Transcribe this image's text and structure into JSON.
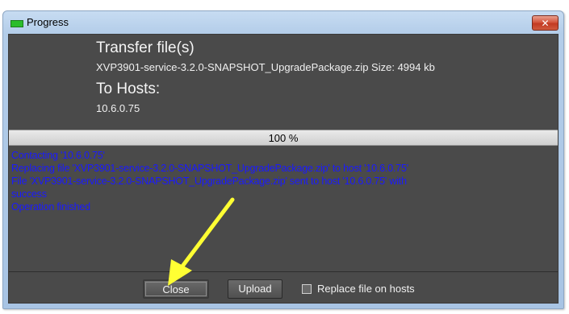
{
  "window": {
    "title": "Progress",
    "close_glyph": "✕"
  },
  "transfer": {
    "heading": "Transfer file(s)",
    "file_info": "XVP3901-service-3.2.0-SNAPSHOT_UpgradePackage.zip Size: 4994 kb",
    "hosts_heading": "To Hosts:",
    "host": "10.6.0.75"
  },
  "progress": {
    "value": 100,
    "label": "100 %"
  },
  "log": {
    "color": "#1a1aff",
    "lines": [
      "Contacting '10.6.0.75'",
      "Replacing file 'XVP3901-service-3.2.0-SNAPSHOT_UpgradePackage.zip' to host '10.6.0.75'",
      "File  'XVP3901-service-3.2.0-SNAPSHOT_UpgradePackage.zip' sent to host '10.6.0.75' with",
      "success",
      "Operation finished"
    ]
  },
  "footer": {
    "close_label": "Close",
    "upload_label": "Upload",
    "replace_label": "Replace file on hosts",
    "replace_checked": false
  },
  "annotation": {
    "arrow_color": "#ffff33"
  }
}
